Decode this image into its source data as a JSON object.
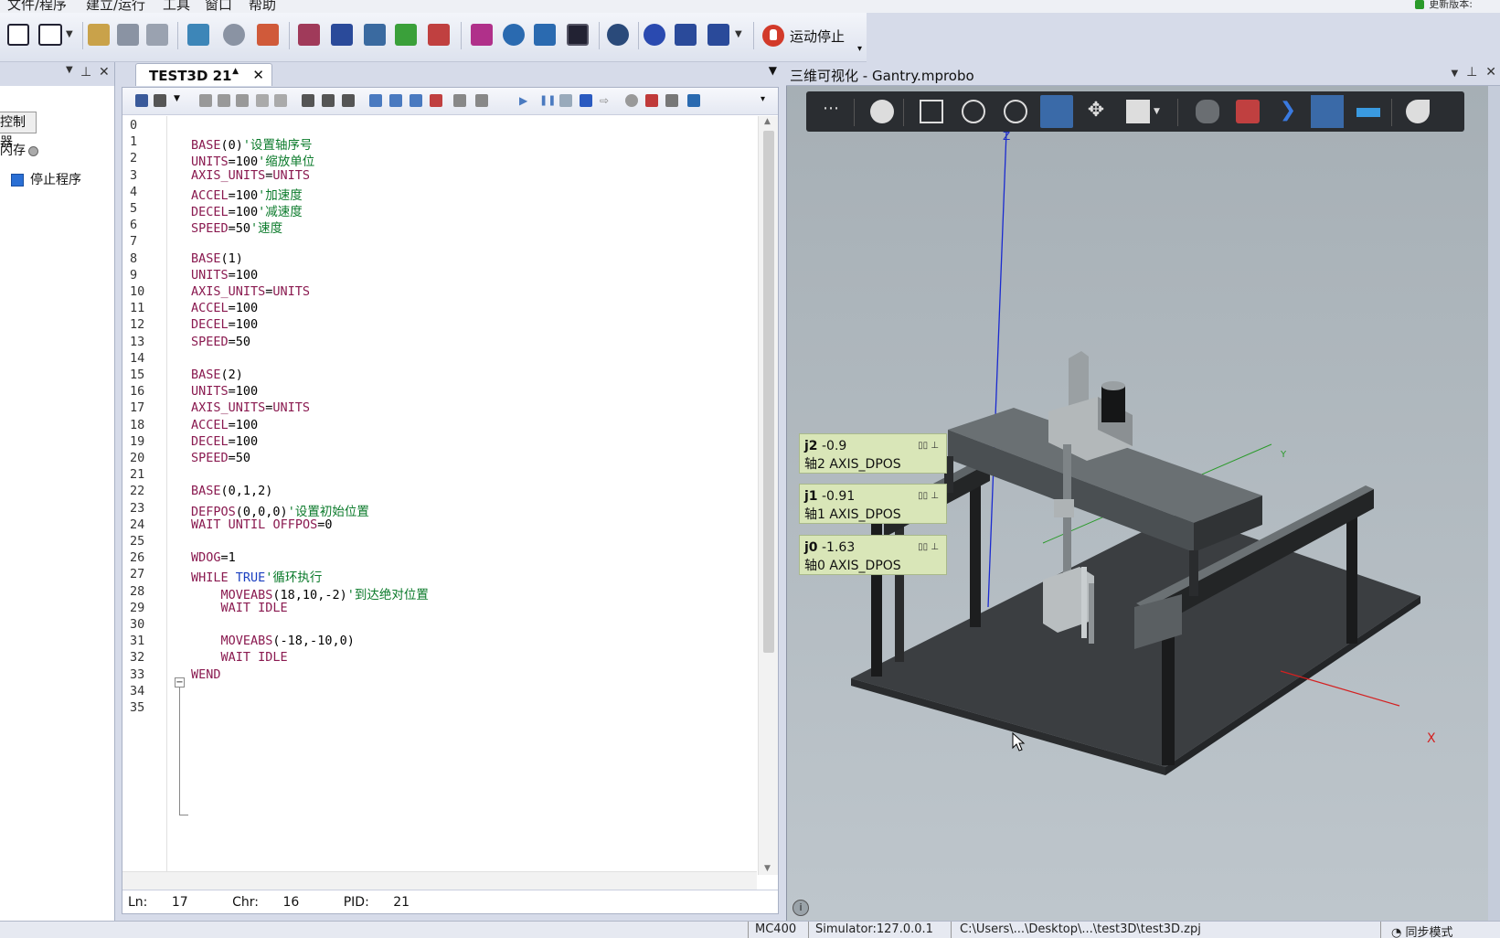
{
  "menubar": {
    "items": [
      "文件/程序",
      "建立/运行",
      "工具",
      "窗口",
      "帮助"
    ],
    "update_text": "更新版本:"
  },
  "toolbar": {
    "stop_label": "运动停止",
    "accent": "#d23a2a"
  },
  "left_panel": {
    "controller_button": "控制器",
    "flash_label": "闪存",
    "stop_program_label": "停止程序"
  },
  "editor": {
    "tab_label": "TEST3D 21",
    "lines": [
      {
        "n": "0",
        "t": ""
      },
      {
        "n": "1",
        "t": "BASE(0)'设置轴序号"
      },
      {
        "n": "2",
        "t": "UNITS=100'缩放单位"
      },
      {
        "n": "3",
        "t": "AXIS_UNITS=UNITS"
      },
      {
        "n": "4",
        "t": "ACCEL=100'加速度"
      },
      {
        "n": "5",
        "t": "DECEL=100'减速度"
      },
      {
        "n": "6",
        "t": "SPEED=50'速度"
      },
      {
        "n": "7",
        "t": ""
      },
      {
        "n": "8",
        "t": "BASE(1)"
      },
      {
        "n": "9",
        "t": "UNITS=100"
      },
      {
        "n": "10",
        "t": "AXIS_UNITS=UNITS"
      },
      {
        "n": "11",
        "t": "ACCEL=100"
      },
      {
        "n": "12",
        "t": "DECEL=100"
      },
      {
        "n": "13",
        "t": "SPEED=50"
      },
      {
        "n": "14",
        "t": ""
      },
      {
        "n": "15",
        "t": "BASE(2)"
      },
      {
        "n": "16",
        "t": "UNITS=100"
      },
      {
        "n": "17",
        "t": "AXIS_UNITS=UNITS"
      },
      {
        "n": "18",
        "t": "ACCEL=100"
      },
      {
        "n": "19",
        "t": "DECEL=100"
      },
      {
        "n": "20",
        "t": "SPEED=50"
      },
      {
        "n": "21",
        "t": ""
      },
      {
        "n": "22",
        "t": "BASE(0,1,2)"
      },
      {
        "n": "23",
        "t": "DEFPOS(0,0,0)'设置初始位置"
      },
      {
        "n": "24",
        "t": "WAIT UNTIL OFFPOS=0"
      },
      {
        "n": "25",
        "t": ""
      },
      {
        "n": "26",
        "t": "WDOG=1"
      },
      {
        "n": "27",
        "t": "WHILE TRUE'循环执行"
      },
      {
        "n": "28",
        "t": "    MOVEABS(18,10,-2)'到达绝对位置"
      },
      {
        "n": "29",
        "t": "    WAIT IDLE"
      },
      {
        "n": "30",
        "t": ""
      },
      {
        "n": "31",
        "t": "    MOVEABS(-18,-10,0)"
      },
      {
        "n": "32",
        "t": "    WAIT IDLE"
      },
      {
        "n": "33",
        "t": "WEND"
      },
      {
        "n": "34",
        "t": ""
      },
      {
        "n": "35",
        "t": ""
      }
    ],
    "status": {
      "ln_label": "Ln:",
      "ln": "17",
      "chr_label": "Chr:",
      "chr": "16",
      "pid_label": "PID:",
      "pid": "21"
    }
  },
  "viz": {
    "title": "三维可视化 - Gantry.mprobo",
    "dros": [
      {
        "name": "j2",
        "value": "-0.9",
        "label": "轴2  AXIS_DPOS"
      },
      {
        "name": "j1",
        "value": "-0.91",
        "label": "轴1  AXIS_DPOS"
      },
      {
        "name": "j0",
        "value": "-1.63",
        "label": "轴0  AXIS_DPOS"
      }
    ],
    "axis_x": "X",
    "axis_y": "Y",
    "axis_z": "Z"
  },
  "statusbar": {
    "items": [
      "MC400",
      "Simulator:127.0.0.1",
      "C:\\Users\\...\\Desktop\\...\\test3D\\test3D.zpj",
      "同步模式"
    ]
  }
}
